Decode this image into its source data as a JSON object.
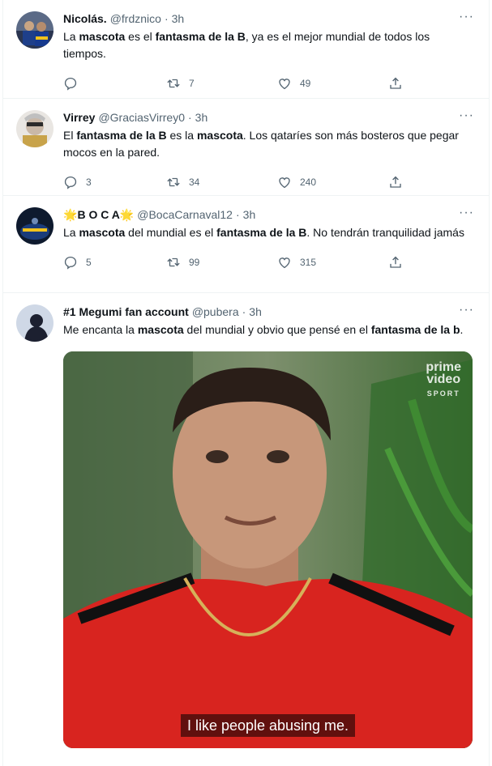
{
  "tweets": [
    {
      "name": "Nicolás.",
      "handle": "@frdznico",
      "time": "3h",
      "text_parts": [
        {
          "t": "La ",
          "b": false
        },
        {
          "t": "mascota",
          "b": true
        },
        {
          "t": " es el ",
          "b": false
        },
        {
          "t": "fantasma de la B",
          "b": true
        },
        {
          "t": ", ya es el mejor mundial de todos los tiempos.",
          "b": false
        }
      ],
      "replies": "",
      "retweets": "7",
      "likes": "49"
    },
    {
      "name": "Virrey",
      "handle": "@GraciasVirrey0",
      "time": "3h",
      "text_parts": [
        {
          "t": "El ",
          "b": false
        },
        {
          "t": "fantasma de la B",
          "b": true
        },
        {
          "t": " es la ",
          "b": false
        },
        {
          "t": "mascota",
          "b": true
        },
        {
          "t": ". Los qataríes son más bosteros que pegar mocos en la pared.",
          "b": false
        }
      ],
      "replies": "3",
      "retweets": "34",
      "likes": "240"
    },
    {
      "name_prefix": "🌟",
      "name": "B O C A",
      "name_suffix": "🌟",
      "handle": "@BocaCarnaval12",
      "time": "3h",
      "text_parts": [
        {
          "t": "La ",
          "b": false
        },
        {
          "t": "mascota",
          "b": true
        },
        {
          "t": " del mundial es el ",
          "b": false
        },
        {
          "t": "fantasma de la B",
          "b": true
        },
        {
          "t": ". No tendrán tranquilidad jamás",
          "b": false
        }
      ],
      "replies": "5",
      "retweets": "99",
      "likes": "315"
    },
    {
      "name": "#1 Megumi fan account",
      "handle": "@pubera",
      "time": "3h",
      "text_parts": [
        {
          "t": "Me encanta la ",
          "b": false
        },
        {
          "t": "mascota",
          "b": true
        },
        {
          "t": " del mundial y obvio que pensé en el ",
          "b": false
        },
        {
          "t": "fantasma de la b",
          "b": true
        },
        {
          "t": ".",
          "b": false
        }
      ],
      "media": {
        "caption": "I like people abusing me.",
        "brand_line1": "prime",
        "brand_line2": "video",
        "brand_line3": "SPORT"
      }
    }
  ],
  "ui": {
    "separator": "·",
    "more": "···"
  },
  "icons": [
    "reply-icon",
    "retweet-icon",
    "like-icon",
    "share-icon",
    "more-icon"
  ],
  "colors": {
    "text": "#0f1419",
    "secondary": "#536471",
    "border": "#eff3f4",
    "star": "#f4a81d"
  }
}
